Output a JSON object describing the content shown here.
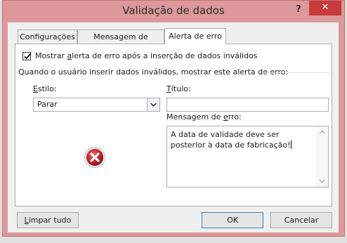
{
  "window": {
    "title": "Validação de dados",
    "help_label": "?",
    "close_label": "✕"
  },
  "tabs": [
    {
      "label": "Configurações",
      "active": false
    },
    {
      "label": "Mensagem de entrada",
      "active": false
    },
    {
      "label": "Alerta de erro",
      "active": true
    }
  ],
  "show_alert": {
    "checked": true,
    "label_pre": "Mostrar ",
    "label_key": "a",
    "label_post": "lerta de erro após a inserção de dados inválidos"
  },
  "group_label": "Quando o usuário inserir dados inválidos, mostrar este alerta de erro:",
  "style": {
    "label_key": "E",
    "label_post": "stilo:",
    "value": "Parar",
    "icon": "stop-error-icon"
  },
  "title_field": {
    "label_key": "T",
    "label_post": "ítulo:",
    "value": ""
  },
  "message_field": {
    "label_pre": "Mensagem de ",
    "label_key": "e",
    "label_post": "rro:",
    "value": "A data de validade deve ser posterior à data de fabricação!"
  },
  "buttons": {
    "clear_key": "L",
    "clear_post": "impar tudo",
    "ok": "OK",
    "cancel": "Cancelar"
  },
  "colors": {
    "frame": "#dd9999",
    "close": "#c73a3a",
    "error_icon": "#c1272d"
  }
}
